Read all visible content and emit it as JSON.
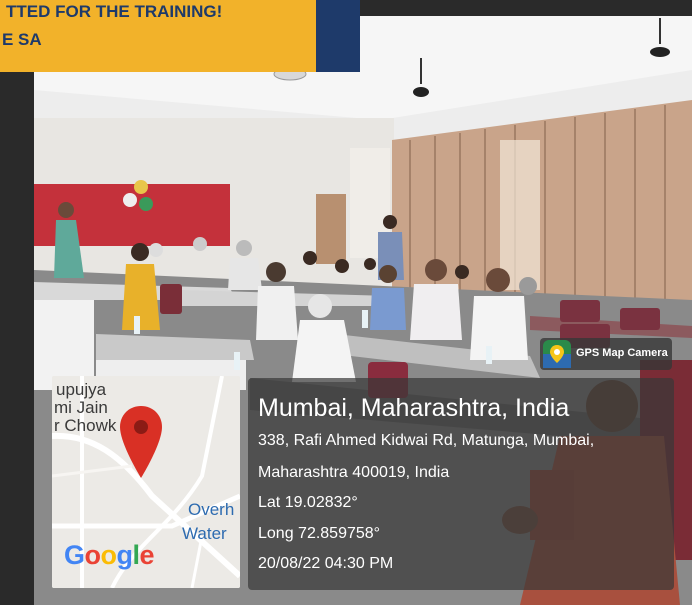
{
  "banner": {
    "line1": "TTED FOR THE TRAINING!",
    "line2": "E SA"
  },
  "gps_badge": {
    "icon": "gps-map-camera-icon",
    "label": "GPS Map Camera"
  },
  "location": {
    "title": "Mumbai, Maharashtra, India",
    "address_line1": "338, Rafi Ahmed Kidwai Rd, Matunga, Mumbai,",
    "address_line2": "Maharashtra 400019, India",
    "lat": "Lat 19.02832°",
    "long": "Long 72.859758°",
    "timestamp": "20/08/22 04:30 PM"
  },
  "map": {
    "labels": [
      "upujya",
      "mi Jain",
      "r Chowk",
      "Overh",
      "Water"
    ],
    "brand": "Google",
    "marker_icon": "map-pin-icon",
    "brand_colors": [
      "#4285F4",
      "#EA4335",
      "#FBBC05",
      "#4285F4",
      "#34A853",
      "#EA4335"
    ],
    "pin_color": "#d93025",
    "road_color": "#ffffff"
  },
  "accent_colors": {
    "banner_bg": "#1e3a6a",
    "banner_strip": "#f2b22a",
    "overlay_bg": "rgba(55,55,55,0.70)",
    "wall_red": "#c4313b",
    "curtain": "#c9a48a"
  }
}
